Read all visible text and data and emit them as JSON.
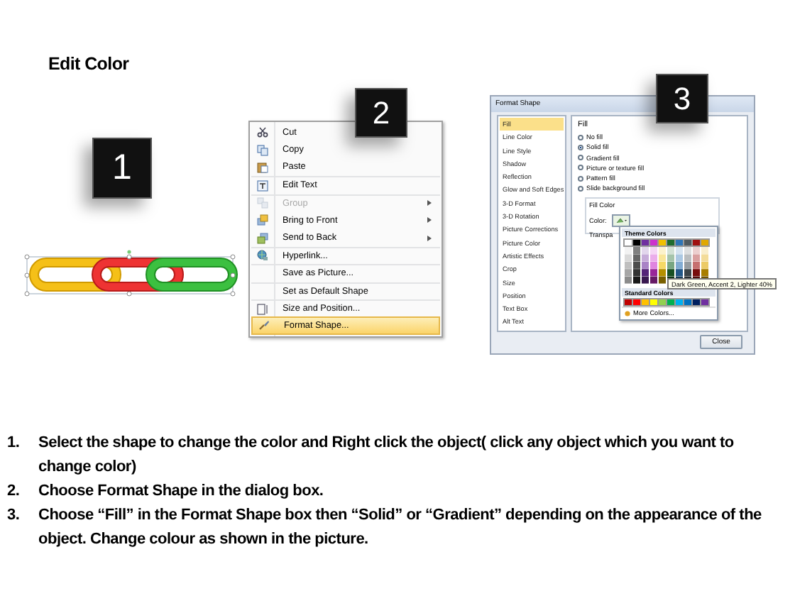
{
  "title": "Edit Color",
  "step_badges": [
    "1",
    "2",
    "3"
  ],
  "context_menu": {
    "items": [
      {
        "label": "Cut",
        "disabled": false,
        "selected": false,
        "submenu": false,
        "separator_before": false
      },
      {
        "label": "Copy",
        "disabled": false,
        "selected": false,
        "submenu": false,
        "separator_before": false
      },
      {
        "label": "Paste",
        "disabled": false,
        "selected": false,
        "submenu": false,
        "separator_before": false
      },
      {
        "label": "Edit Text",
        "disabled": false,
        "selected": false,
        "submenu": false,
        "separator_before": true
      },
      {
        "label": "Group",
        "disabled": true,
        "selected": false,
        "submenu": true,
        "separator_before": true
      },
      {
        "label": "Bring to Front",
        "disabled": false,
        "selected": false,
        "submenu": true,
        "separator_before": false
      },
      {
        "label": "Send to Back",
        "disabled": false,
        "selected": false,
        "submenu": true,
        "separator_before": false
      },
      {
        "label": "Hyperlink...",
        "disabled": false,
        "selected": false,
        "submenu": false,
        "separator_before": true
      },
      {
        "label": "Save as Picture...",
        "disabled": false,
        "selected": false,
        "submenu": false,
        "separator_before": true
      },
      {
        "label": "Set as Default Shape",
        "disabled": false,
        "selected": false,
        "submenu": false,
        "separator_before": true
      },
      {
        "label": "Size and Position...",
        "disabled": false,
        "selected": false,
        "submenu": false,
        "separator_before": true
      },
      {
        "label": "Format Shape...",
        "disabled": false,
        "selected": true,
        "submenu": false,
        "separator_before": false
      }
    ]
  },
  "format_dialog": {
    "title": "Format Shape",
    "categories": [
      {
        "label": "Fill",
        "selected": true
      },
      {
        "label": "Line Color",
        "selected": false
      },
      {
        "label": "Line Style",
        "selected": false
      },
      {
        "label": "Shadow",
        "selected": false
      },
      {
        "label": "Reflection",
        "selected": false
      },
      {
        "label": "Glow and Soft Edges",
        "selected": false
      },
      {
        "label": "3-D Format",
        "selected": false
      },
      {
        "label": "3-D Rotation",
        "selected": false
      },
      {
        "label": "Picture Corrections",
        "selected": false
      },
      {
        "label": "Picture Color",
        "selected": false
      },
      {
        "label": "Artistic Effects",
        "selected": false
      },
      {
        "label": "Crop",
        "selected": false
      },
      {
        "label": "Size",
        "selected": false
      },
      {
        "label": "Position",
        "selected": false
      },
      {
        "label": "Text Box",
        "selected": false
      },
      {
        "label": "Alt Text",
        "selected": false
      }
    ],
    "section_title": "Fill",
    "fill_options": [
      {
        "label": "No fill",
        "selected": false
      },
      {
        "label": "Solid fill",
        "selected": true
      },
      {
        "label": "Gradient fill",
        "selected": false
      },
      {
        "label": "Picture or texture fill",
        "selected": false
      },
      {
        "label": "Pattern fill",
        "selected": false
      },
      {
        "label": "Slide background fill",
        "selected": false
      }
    ],
    "group_title": "Fill Color",
    "color_label": "Color:",
    "transparency_label": "Transpa",
    "palette": {
      "theme_title": "Theme Colors",
      "theme_colors": [
        {
          "color": "#ffffff"
        },
        {
          "color": "#000000"
        },
        {
          "color": "#7030a0"
        },
        {
          "color": "#cc33cc"
        },
        {
          "color": "#f0c000"
        },
        {
          "color": "#1e6b2e"
        },
        {
          "color": "#2e75b6"
        },
        {
          "color": "#505a60"
        },
        {
          "color": "#a01010"
        },
        {
          "color": "#e0a800"
        }
      ],
      "standard_title": "Standard Colors",
      "standard_colors": [
        {
          "color": "#c00000"
        },
        {
          "color": "#ff0000"
        },
        {
          "color": "#ffc000"
        },
        {
          "color": "#ffff00"
        },
        {
          "color": "#92d050"
        },
        {
          "color": "#00b050"
        },
        {
          "color": "#00b0f0"
        },
        {
          "color": "#0070c0"
        },
        {
          "color": "#002060"
        },
        {
          "color": "#7030a0"
        }
      ],
      "more_colors": "More Colors...",
      "tooltip": "Dark Green, Accent 2, Lighter 40%"
    },
    "close_button": "Close"
  },
  "instructions": [
    {
      "number": "1.",
      "text": "Select the shape to change the color and Right click the object( click any object which you want to change color)"
    },
    {
      "number": "2.",
      "text": "Choose Format Shape in the dialog box."
    },
    {
      "number": "3.",
      "text": "Choose “Fill” in the Format Shape box then “Solid” or “Gradient” depending on the appearance of the object. Change colour as shown in the picture."
    }
  ]
}
